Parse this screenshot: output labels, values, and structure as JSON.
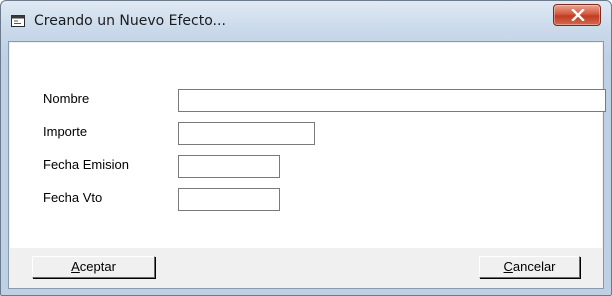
{
  "window": {
    "title": "Creando un Nuevo Efecto..."
  },
  "icons": {
    "app": "form-window-icon",
    "close": "close-icon"
  },
  "form": {
    "fields": [
      {
        "label": "Nombre",
        "value": ""
      },
      {
        "label": "Importe",
        "value": ""
      },
      {
        "label": "Fecha Emision",
        "value": ""
      },
      {
        "label": "Fecha Vto",
        "value": ""
      }
    ]
  },
  "buttons": {
    "accept": {
      "accel": "A",
      "rest": "ceptar"
    },
    "cancel": {
      "accel": "C",
      "rest": "ancelar"
    }
  },
  "colors": {
    "close_button": "#c8452c",
    "titlebar": "#c9d9ea"
  }
}
